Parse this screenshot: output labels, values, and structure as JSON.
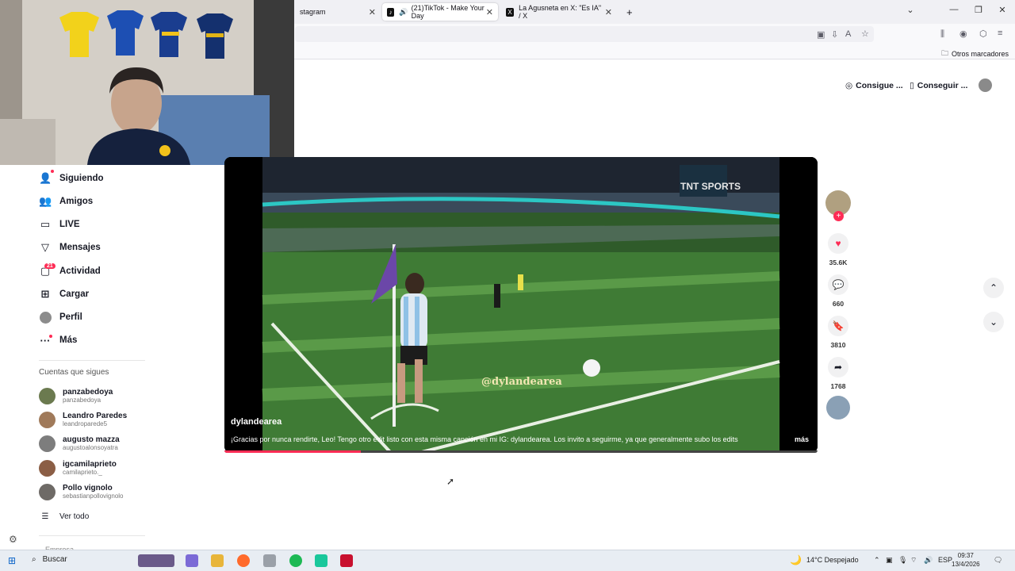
{
  "browser": {
    "tabs": [
      {
        "label": "stagram",
        "active": false
      },
      {
        "label": "(21)TikTok - Make Your Day",
        "active": true
      },
      {
        "label": "La Agusneta en X: \"Es IA\" / X",
        "active": false
      }
    ],
    "new_tab": "+",
    "bookmarks_other": "Otros marcadores"
  },
  "tiktok": {
    "top_actions": [
      "Consigue ...",
      "Conseguir ..."
    ],
    "nav": [
      {
        "label": "Siguiendo",
        "icon": "user-plus-icon"
      },
      {
        "label": "Amigos",
        "icon": "friends-icon"
      },
      {
        "label": "LIVE",
        "icon": "live-icon"
      },
      {
        "label": "Mensajes",
        "icon": "send-icon"
      },
      {
        "label": "Actividad",
        "icon": "activity-icon",
        "badge": "21"
      },
      {
        "label": "Cargar",
        "icon": "upload-icon"
      },
      {
        "label": "Perfil",
        "icon": "profile-icon"
      },
      {
        "label": "Más",
        "icon": "more-icon"
      }
    ],
    "following_title": "Cuentas que sigues",
    "following": [
      {
        "name": "panzabedoya",
        "handle": "panzabedoya"
      },
      {
        "name": "Leandro Paredes",
        "handle": "leandroparede5"
      },
      {
        "name": "augusto mazza",
        "handle": "augustoalonsoyatra"
      },
      {
        "name": "igcamilaprieto",
        "handle": "camilaprieto._"
      },
      {
        "name": "Pollo vignolo",
        "handle": "sebastianpollovignolo"
      }
    ],
    "see_all": "Ver todo",
    "footer_partial": "Empresa",
    "video": {
      "author": "dylandearea",
      "caption": "¡Gracias por nunca rendirte, Leo! Tengo otro edit listo con esta misma canción en mi IG: dylandearea. Los invito a seguirme, ya que generalmente subo los edits",
      "more": "más",
      "watermark": "@dylandearea",
      "broadcaster": "TNT SPORTS",
      "progress": 0.23
    },
    "stats": {
      "likes": "35.6K",
      "comments": "660",
      "saves": "3810",
      "shares": "1768"
    }
  },
  "taskbar": {
    "search": "Buscar",
    "weather": "14°C  Despejado",
    "language": "ESP",
    "time": "09:37",
    "date": "13/4/2026"
  },
  "colors": {
    "accent": "#fe2c55",
    "pitch": "#3f7b35"
  }
}
